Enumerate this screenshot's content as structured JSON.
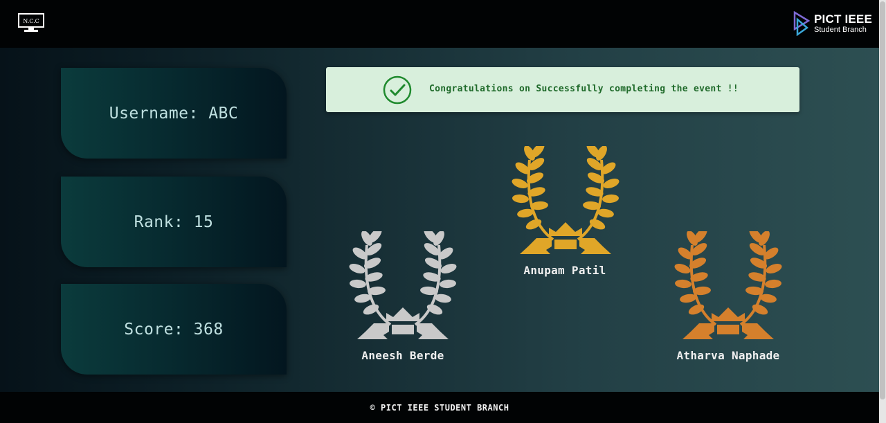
{
  "header": {
    "left_logo_text": "N.C.C",
    "brand_title": "PICT IEEE",
    "brand_subtitle": "Student Branch"
  },
  "stats": {
    "username": "Username: ABC",
    "rank": "Rank: 15",
    "score": "Score: 368"
  },
  "banner": {
    "message": "Congratulations on Successfully completing the event !!"
  },
  "podium": {
    "first": {
      "name": "Anupam Patil",
      "color": "#e0a628"
    },
    "second": {
      "name": "Aneesh Berde",
      "color": "#c9c9c9"
    },
    "third": {
      "name": "Atharva Naphade",
      "color": "#d5802c"
    }
  },
  "footer": {
    "copyright": "© PICT IEEE STUDENT BRANCH"
  }
}
